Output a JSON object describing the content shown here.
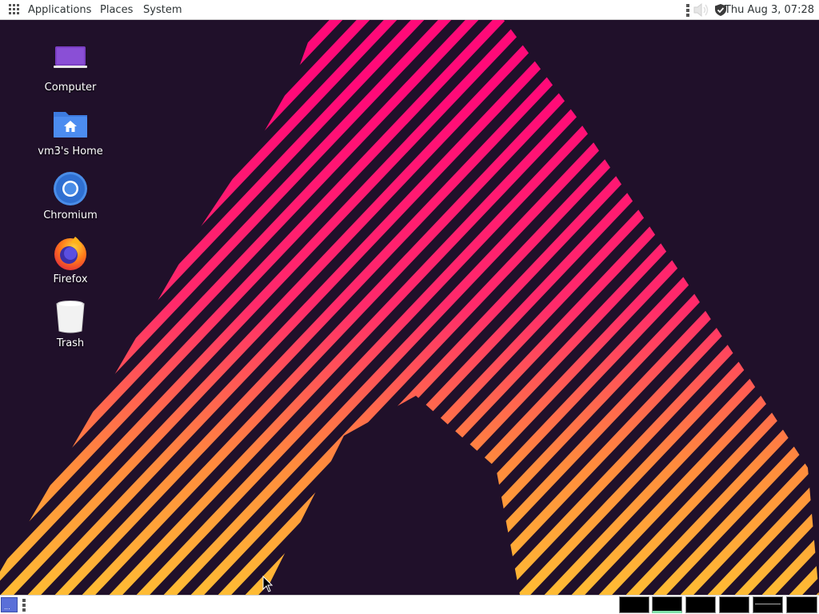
{
  "top_panel": {
    "menus": [
      "Applications",
      "Places",
      "System"
    ],
    "clock": "Thu Aug  3, 07:28",
    "icons": [
      "apps-grid-icon",
      "panel-handle-icon",
      "volume-muted-icon",
      "shield-icon"
    ]
  },
  "desktop": {
    "icons": [
      {
        "label": "Computer",
        "icon": "laptop-icon"
      },
      {
        "label": "vm3's Home",
        "icon": "home-folder-icon"
      },
      {
        "label": "Chromium",
        "icon": "chromium-icon"
      },
      {
        "label": "Firefox",
        "icon": "firefox-icon"
      },
      {
        "label": "Trash",
        "icon": "trash-icon"
      }
    ]
  },
  "bottom_panel": {
    "show_desktop_text": "...",
    "workspaces": [
      {
        "name": "workspace-1",
        "active": false
      },
      {
        "name": "workspace-2",
        "active": true
      },
      {
        "name": "workspace-3",
        "active": false
      },
      {
        "name": "workspace-4",
        "active": false
      },
      {
        "name": "workspace-5",
        "active": false
      },
      {
        "name": "workspace-6",
        "active": false
      }
    ]
  },
  "colors": {
    "wallpaper_bg": "#20102a",
    "stripe_pink": "#ff0a78",
    "stripe_orange": "#ff8c3c",
    "stripe_yellow": "#ffc832",
    "panel_bg": "#ffffff",
    "workspace_active_indicator": "#7fe0a8"
  }
}
